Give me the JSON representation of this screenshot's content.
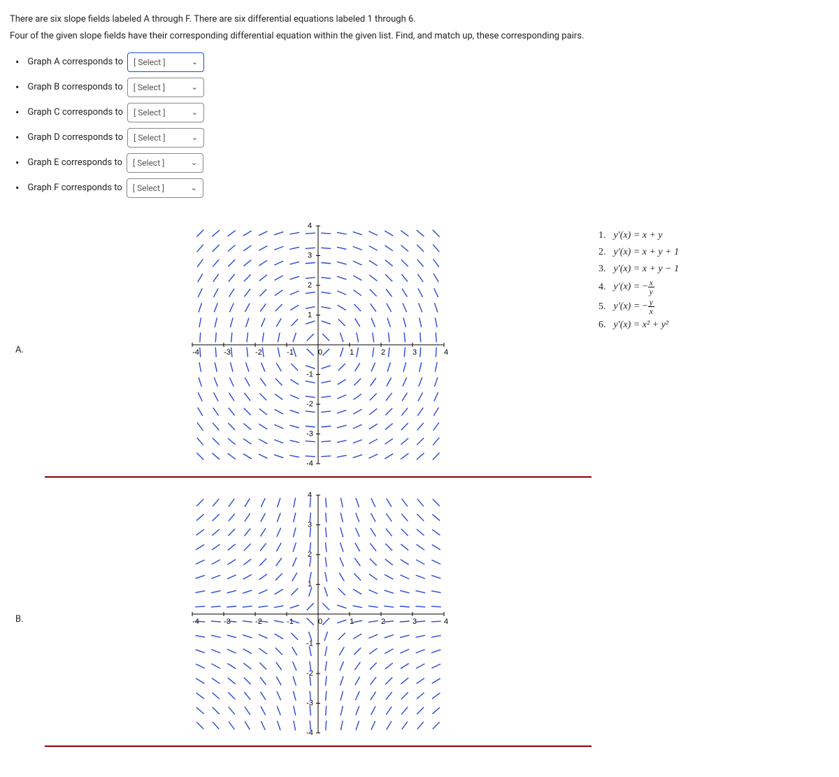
{
  "intro": {
    "line1": "There are six slope fields labeled A through F. There are six differential equations labeled 1 through 6.",
    "line2": "Four of the given slope fields have their corresponding differential equation within the given list. Find, and match up, these corresponding pairs."
  },
  "select_placeholder": "[ Select ]",
  "matches": [
    {
      "label": "Graph A corresponds to",
      "active": true
    },
    {
      "label": "Graph B corresponds to",
      "active": false
    },
    {
      "label": "Graph C corresponds to",
      "active": false
    },
    {
      "label": "Graph D corresponds to",
      "active": false
    },
    {
      "label": "Graph E corresponds to",
      "active": false
    },
    {
      "label": "Graph F corresponds to",
      "active": false
    }
  ],
  "equations": [
    {
      "n": "1.",
      "lhs": "y′(x) =",
      "rhs_type": "plain",
      "rhs": "x + y"
    },
    {
      "n": "2.",
      "lhs": "y′(x) =",
      "rhs_type": "plain",
      "rhs": "x + y + 1"
    },
    {
      "n": "3.",
      "lhs": "y′(x) =",
      "rhs_type": "plain",
      "rhs": "x + y − 1"
    },
    {
      "n": "4.",
      "lhs": "y′(x) =",
      "rhs_type": "frac",
      "sign": "−",
      "num": "x",
      "den": "y"
    },
    {
      "n": "5.",
      "lhs": "y′(x) =",
      "rhs_type": "frac",
      "sign": "−",
      "num": "y",
      "den": "x"
    },
    {
      "n": "6.",
      "lhs": "y′(x) =",
      "rhs_type": "plain",
      "rhs": "x² + y²"
    }
  ],
  "graphs": [
    {
      "label": "A.",
      "field": "neg_x_over_y"
    },
    {
      "label": "B.",
      "field": "neg_y_over_x"
    }
  ],
  "chart_data": [
    {
      "type": "slope_field",
      "label": "A",
      "equation": "dy/dx = -x / y",
      "x_range": [
        -4,
        4
      ],
      "y_range": [
        -4,
        4
      ],
      "x_ticks": [
        -4,
        -3,
        -2,
        -1,
        0,
        1,
        2,
        3,
        4
      ],
      "y_ticks": [
        -4,
        -3,
        -2,
        -1,
        1,
        2,
        3,
        4
      ],
      "grid_step": 0.5
    },
    {
      "type": "slope_field",
      "label": "B",
      "equation": "dy/dx = -y / x",
      "x_range": [
        -4,
        4
      ],
      "y_range": [
        -4,
        4
      ],
      "x_ticks": [
        -4,
        -3,
        -2,
        -1,
        0,
        1,
        2,
        3,
        4
      ],
      "y_ticks": [
        -4,
        -3,
        -2,
        -1,
        1,
        2,
        3,
        4
      ],
      "grid_step": 0.5
    }
  ]
}
